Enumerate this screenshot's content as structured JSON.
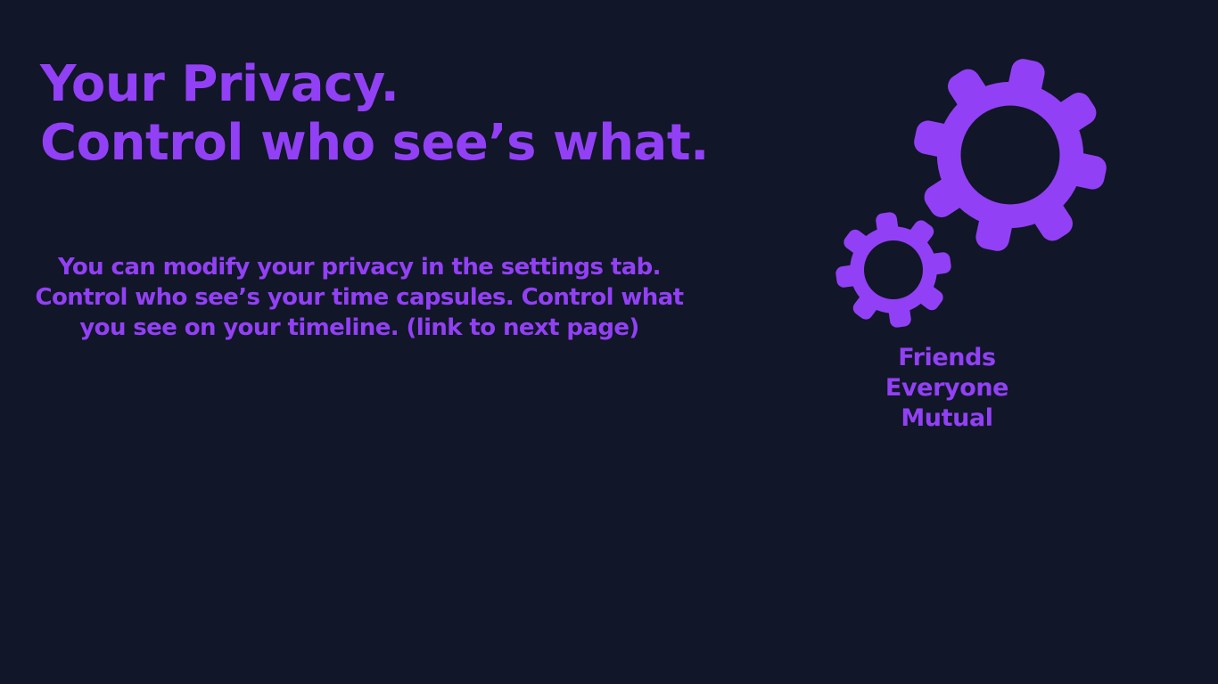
{
  "colors": {
    "background": "#111628",
    "accent": "#9240f5"
  },
  "hero": {
    "line1": "Your Privacy.",
    "line2": "Control who see’s what."
  },
  "description": "You can modify your privacy in the settings tab. Control who see’s your time capsules. Control what you see on your timeline. (link to next page)",
  "illustration": {
    "icon": "gears-icon"
  },
  "privacy_options": [
    {
      "label": "Friends"
    },
    {
      "label": "Everyone"
    },
    {
      "label": "Mutual"
    }
  ]
}
